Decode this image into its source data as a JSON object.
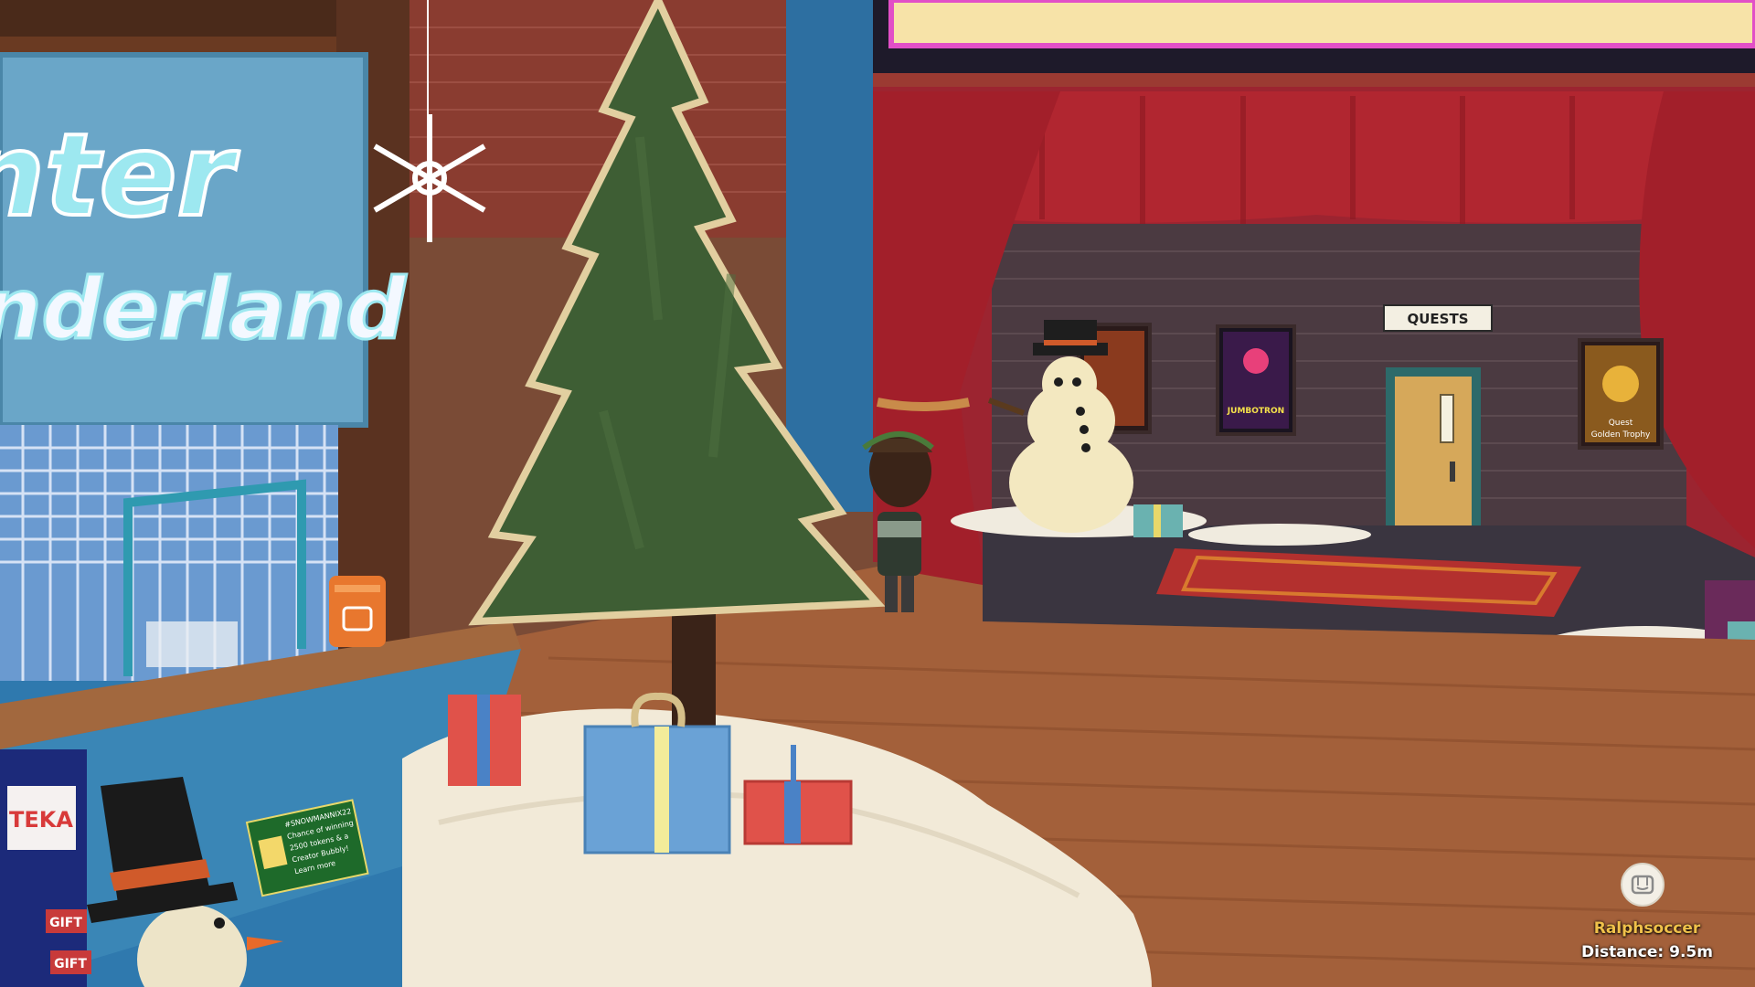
{
  "scene": {
    "sign_line1": "nter",
    "sign_line2": "nderland",
    "quests_sign": "QUESTS",
    "gift_tag_1": "GIFT",
    "gift_tag_2": "GIFT",
    "arcade_label": "TEKA",
    "poster_2_text": "JUMBOTRON",
    "poster_3_line1": "Quest",
    "poster_3_line2": "Golden Trophy",
    "info_card": {
      "line1": "#SNOWMANNIX22",
      "line2": "Chance of winning",
      "line3": "2500 tokens & a",
      "line4": "Creator Bubbly!",
      "line5": "Learn more"
    }
  },
  "hud": {
    "player_name": "Ralphsoccer",
    "distance": "Distance: 9.5m",
    "avatar_icon": "rec-room-face-icon"
  },
  "colors": {
    "player_name": "#f0c14a",
    "curtain": "#a8202a",
    "floor": "#a3603a",
    "sign_bg": "#6aa6c8",
    "tree": "#3e5e34"
  }
}
